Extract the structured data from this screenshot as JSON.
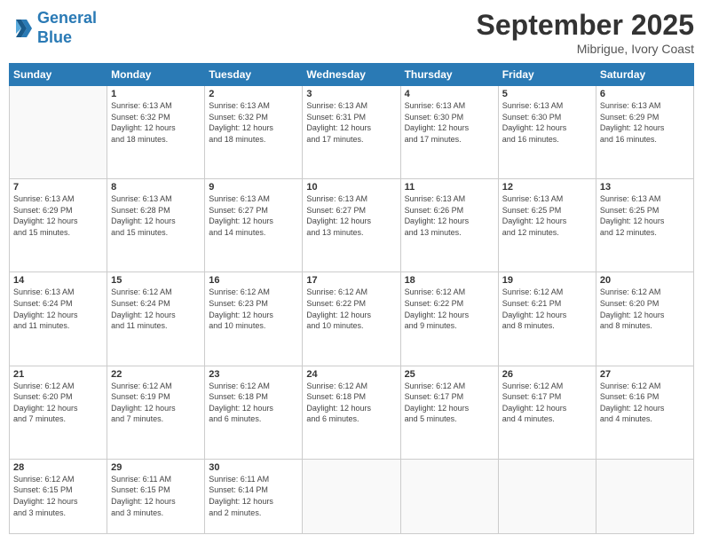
{
  "logo": {
    "line1": "General",
    "line2": "Blue"
  },
  "title": "September 2025",
  "subtitle": "Mibrigue, Ivory Coast",
  "days_of_week": [
    "Sunday",
    "Monday",
    "Tuesday",
    "Wednesday",
    "Thursday",
    "Friday",
    "Saturday"
  ],
  "weeks": [
    [
      {
        "num": "",
        "info": ""
      },
      {
        "num": "1",
        "info": "Sunrise: 6:13 AM\nSunset: 6:32 PM\nDaylight: 12 hours\nand 18 minutes."
      },
      {
        "num": "2",
        "info": "Sunrise: 6:13 AM\nSunset: 6:32 PM\nDaylight: 12 hours\nand 18 minutes."
      },
      {
        "num": "3",
        "info": "Sunrise: 6:13 AM\nSunset: 6:31 PM\nDaylight: 12 hours\nand 17 minutes."
      },
      {
        "num": "4",
        "info": "Sunrise: 6:13 AM\nSunset: 6:30 PM\nDaylight: 12 hours\nand 17 minutes."
      },
      {
        "num": "5",
        "info": "Sunrise: 6:13 AM\nSunset: 6:30 PM\nDaylight: 12 hours\nand 16 minutes."
      },
      {
        "num": "6",
        "info": "Sunrise: 6:13 AM\nSunset: 6:29 PM\nDaylight: 12 hours\nand 16 minutes."
      }
    ],
    [
      {
        "num": "7",
        "info": "Sunrise: 6:13 AM\nSunset: 6:29 PM\nDaylight: 12 hours\nand 15 minutes."
      },
      {
        "num": "8",
        "info": "Sunrise: 6:13 AM\nSunset: 6:28 PM\nDaylight: 12 hours\nand 15 minutes."
      },
      {
        "num": "9",
        "info": "Sunrise: 6:13 AM\nSunset: 6:27 PM\nDaylight: 12 hours\nand 14 minutes."
      },
      {
        "num": "10",
        "info": "Sunrise: 6:13 AM\nSunset: 6:27 PM\nDaylight: 12 hours\nand 13 minutes."
      },
      {
        "num": "11",
        "info": "Sunrise: 6:13 AM\nSunset: 6:26 PM\nDaylight: 12 hours\nand 13 minutes."
      },
      {
        "num": "12",
        "info": "Sunrise: 6:13 AM\nSunset: 6:25 PM\nDaylight: 12 hours\nand 12 minutes."
      },
      {
        "num": "13",
        "info": "Sunrise: 6:13 AM\nSunset: 6:25 PM\nDaylight: 12 hours\nand 12 minutes."
      }
    ],
    [
      {
        "num": "14",
        "info": "Sunrise: 6:13 AM\nSunset: 6:24 PM\nDaylight: 12 hours\nand 11 minutes."
      },
      {
        "num": "15",
        "info": "Sunrise: 6:12 AM\nSunset: 6:24 PM\nDaylight: 12 hours\nand 11 minutes."
      },
      {
        "num": "16",
        "info": "Sunrise: 6:12 AM\nSunset: 6:23 PM\nDaylight: 12 hours\nand 10 minutes."
      },
      {
        "num": "17",
        "info": "Sunrise: 6:12 AM\nSunset: 6:22 PM\nDaylight: 12 hours\nand 10 minutes."
      },
      {
        "num": "18",
        "info": "Sunrise: 6:12 AM\nSunset: 6:22 PM\nDaylight: 12 hours\nand 9 minutes."
      },
      {
        "num": "19",
        "info": "Sunrise: 6:12 AM\nSunset: 6:21 PM\nDaylight: 12 hours\nand 8 minutes."
      },
      {
        "num": "20",
        "info": "Sunrise: 6:12 AM\nSunset: 6:20 PM\nDaylight: 12 hours\nand 8 minutes."
      }
    ],
    [
      {
        "num": "21",
        "info": "Sunrise: 6:12 AM\nSunset: 6:20 PM\nDaylight: 12 hours\nand 7 minutes."
      },
      {
        "num": "22",
        "info": "Sunrise: 6:12 AM\nSunset: 6:19 PM\nDaylight: 12 hours\nand 7 minutes."
      },
      {
        "num": "23",
        "info": "Sunrise: 6:12 AM\nSunset: 6:18 PM\nDaylight: 12 hours\nand 6 minutes."
      },
      {
        "num": "24",
        "info": "Sunrise: 6:12 AM\nSunset: 6:18 PM\nDaylight: 12 hours\nand 6 minutes."
      },
      {
        "num": "25",
        "info": "Sunrise: 6:12 AM\nSunset: 6:17 PM\nDaylight: 12 hours\nand 5 minutes."
      },
      {
        "num": "26",
        "info": "Sunrise: 6:12 AM\nSunset: 6:17 PM\nDaylight: 12 hours\nand 4 minutes."
      },
      {
        "num": "27",
        "info": "Sunrise: 6:12 AM\nSunset: 6:16 PM\nDaylight: 12 hours\nand 4 minutes."
      }
    ],
    [
      {
        "num": "28",
        "info": "Sunrise: 6:12 AM\nSunset: 6:15 PM\nDaylight: 12 hours\nand 3 minutes."
      },
      {
        "num": "29",
        "info": "Sunrise: 6:11 AM\nSunset: 6:15 PM\nDaylight: 12 hours\nand 3 minutes."
      },
      {
        "num": "30",
        "info": "Sunrise: 6:11 AM\nSunset: 6:14 PM\nDaylight: 12 hours\nand 2 minutes."
      },
      {
        "num": "",
        "info": ""
      },
      {
        "num": "",
        "info": ""
      },
      {
        "num": "",
        "info": ""
      },
      {
        "num": "",
        "info": ""
      }
    ]
  ]
}
